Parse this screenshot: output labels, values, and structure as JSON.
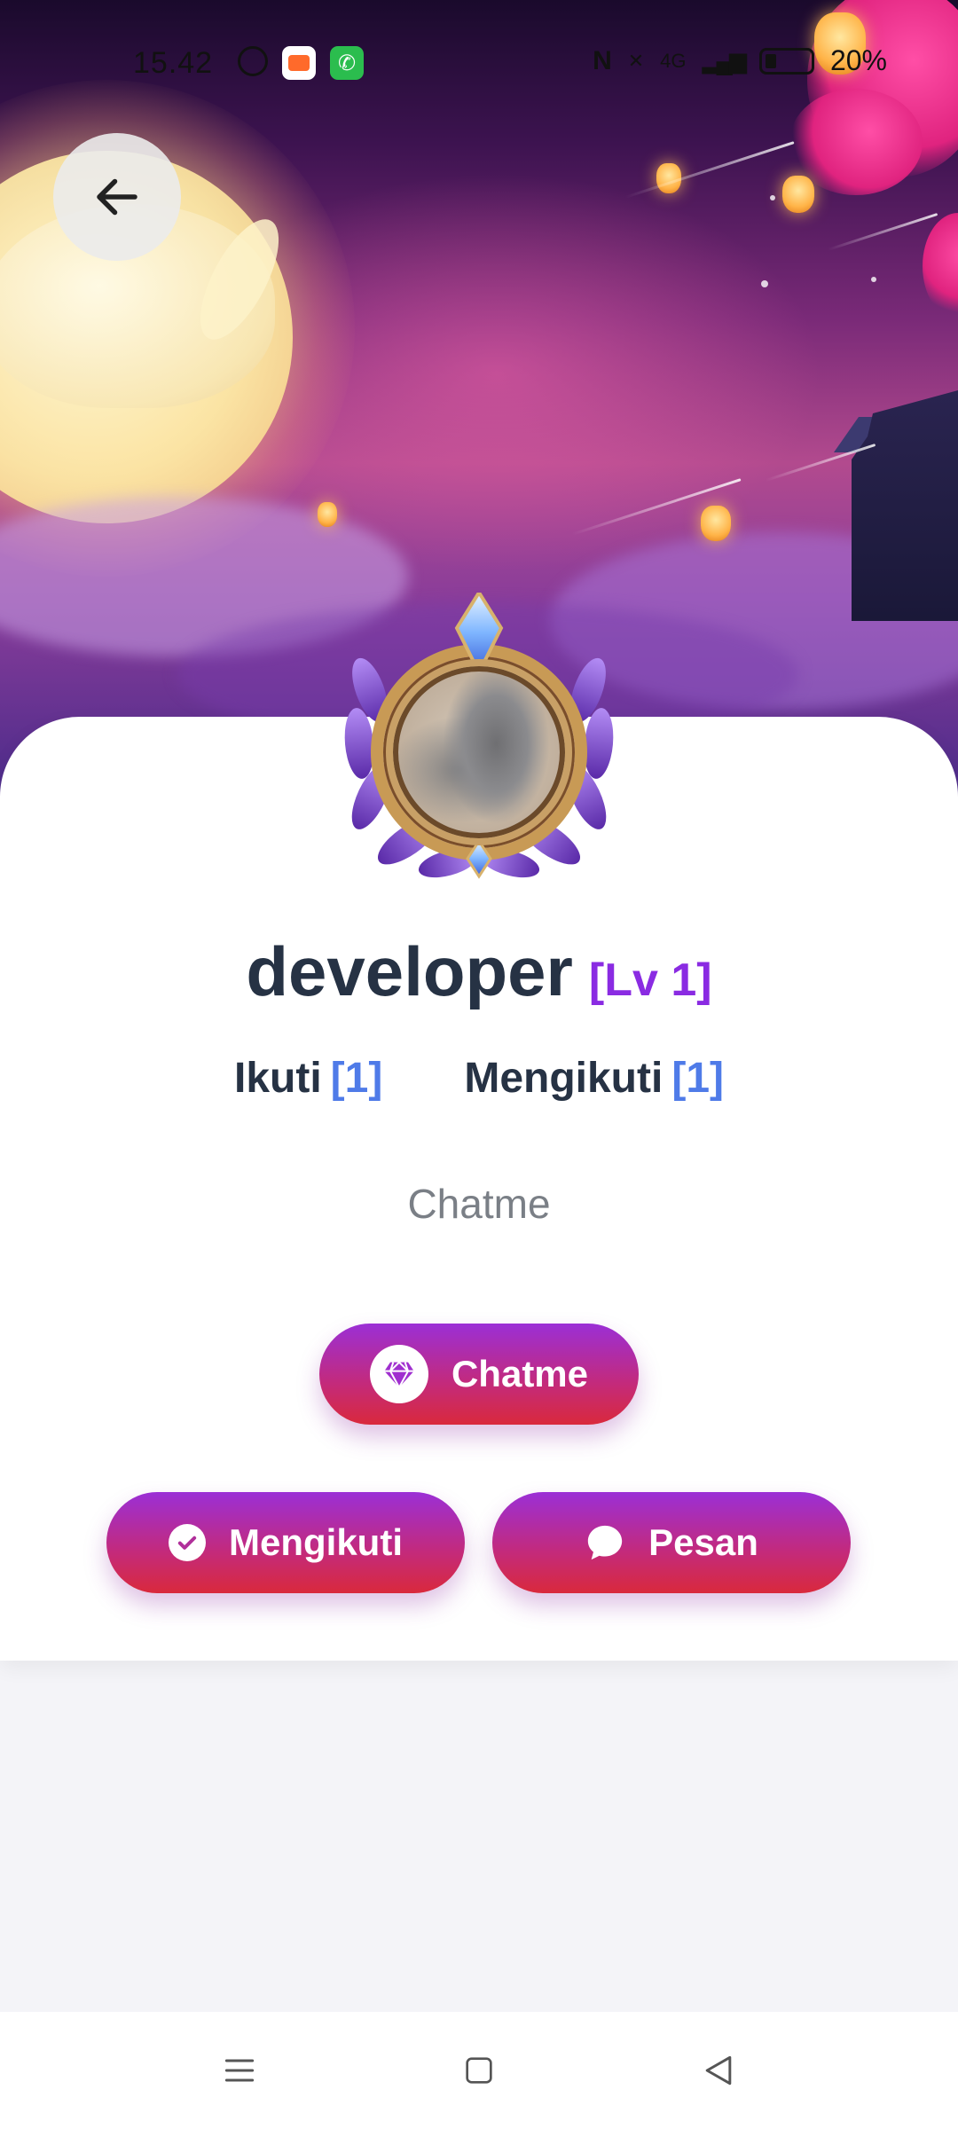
{
  "status_bar": {
    "time": "15.42",
    "battery": "20%"
  },
  "profile": {
    "username": "developer",
    "level": "[Lv 1]",
    "followers_label": "Ikuti",
    "followers_count": "[1]",
    "following_label": "Mengikuti",
    "following_count": "[1]",
    "bio": "Chatme"
  },
  "buttons": {
    "chatme_label": "Chatme",
    "follow_label": "Mengikuti",
    "message_label": "Pesan"
  },
  "icons": {
    "back": "arrow-left-icon",
    "chatme": "diamond-icon",
    "follow": "check-circle-icon",
    "message": "chat-bubble-icon",
    "nav_menu": "menu-icon",
    "nav_home": "square-icon",
    "nav_back": "triangle-back-icon"
  },
  "colors": {
    "button_gradient_top": "#9b2fd6",
    "button_gradient_bottom": "#d9293c",
    "level": "#8a2be2",
    "count": "#4f7be8",
    "username": "#263244"
  }
}
